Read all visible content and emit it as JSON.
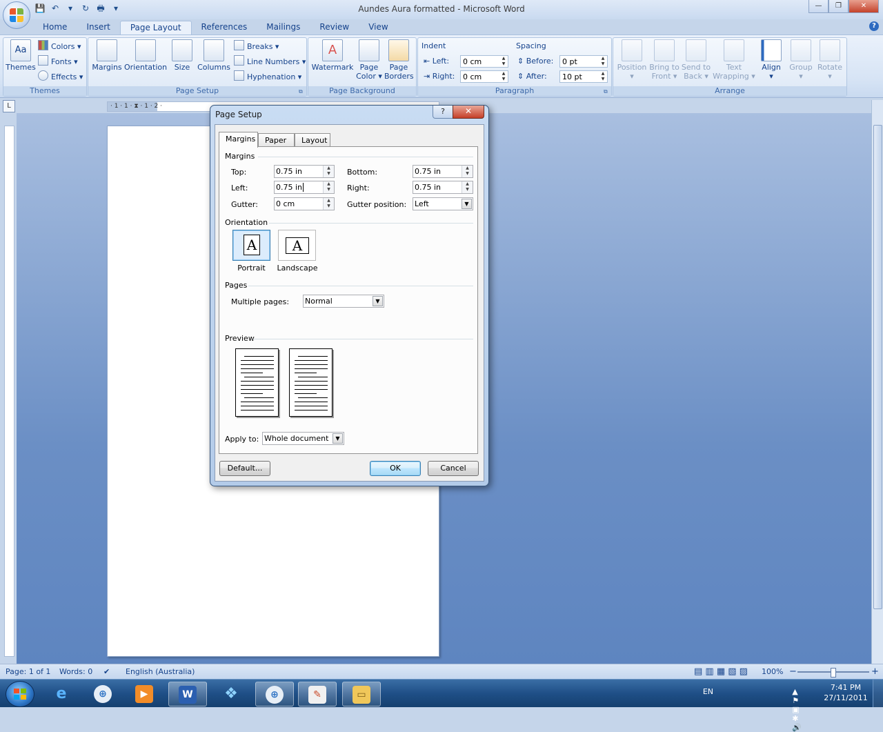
{
  "window": {
    "title": "Aundes Aura formatted - Microsoft Word",
    "minimize": "—",
    "maximize": "❐",
    "close": "✕"
  },
  "qat": {
    "save": "💾",
    "undo": "↶",
    "redo": "↻",
    "print": "🖶",
    "customize": "▾"
  },
  "tabs": [
    {
      "label": "Home"
    },
    {
      "label": "Insert"
    },
    {
      "label": "Page Layout"
    },
    {
      "label": "References"
    },
    {
      "label": "Mailings"
    },
    {
      "label": "Review"
    },
    {
      "label": "View"
    }
  ],
  "help": "?",
  "ribbon": {
    "themes": {
      "label": "Themes",
      "themes_btn": "Themes",
      "colors": "Colors ▾",
      "fonts": "Fonts ▾",
      "effects": "Effects ▾",
      "aa": "Aa"
    },
    "page_setup": {
      "label": "Page Setup",
      "margins": "Margins",
      "orientation": "Orientation",
      "size": "Size",
      "columns": "Columns",
      "breaks": "Breaks ▾",
      "line_numbers": "Line Numbers ▾",
      "hyphenation": "Hyphenation ▾",
      "dd": "▾"
    },
    "page_background": {
      "label": "Page Background",
      "watermark": "Watermark",
      "page_color_1": "Page",
      "page_color_2": "Color ▾",
      "page_borders_1": "Page",
      "page_borders_2": "Borders"
    },
    "paragraph": {
      "label": "Paragraph",
      "indent_title": "Indent",
      "spacing_title": "Spacing",
      "left_label": "Left:",
      "left_value": "0 cm",
      "right_label": "Right:",
      "right_value": "0 cm",
      "before_label": "Before:",
      "before_value": "0 pt",
      "after_label": "After:",
      "after_value": "10 pt"
    },
    "arrange": {
      "label": "Arrange",
      "position": "Position",
      "bring_1": "Bring to",
      "bring_2": "Front ▾",
      "send_1": "Send to",
      "send_2": "Back ▾",
      "wrap_1": "Text",
      "wrap_2": "Wrapping ▾",
      "align": "Align",
      "group": "Group",
      "rotate": "Rotate",
      "dd": "▾"
    }
  },
  "ruler": {
    "corner": "L",
    "marks": "· 1 · 1 · ⧗ · 1 · 2 ·"
  },
  "dialog": {
    "title": "Page Setup",
    "help_btn": "?",
    "close_btn": "✕",
    "tabs": [
      {
        "label": "Margins"
      },
      {
        "label": "Paper"
      },
      {
        "label": "Layout"
      }
    ],
    "margins_section": "Margins",
    "top_label": "Top:",
    "top_value": "0.75 in",
    "bottom_label": "Bottom:",
    "bottom_value": "0.75 in",
    "left_label": "Left:",
    "left_value": "0.75 in",
    "right_label": "Right:",
    "right_value": "0.75 in",
    "gutter_label": "Gutter:",
    "gutter_value": "0 cm",
    "gutter_pos_label": "Gutter position:",
    "gutter_pos_value": "Left",
    "orientation_section": "Orientation",
    "portrait": "Portrait",
    "landscape": "Landscape",
    "glyph": "A",
    "pages_section": "Pages",
    "multiple_pages_label": "Multiple pages:",
    "multiple_pages_value": "Normal",
    "preview_section": "Preview",
    "apply_to_label": "Apply to:",
    "apply_to_value": "Whole document",
    "default_btn": "Default...",
    "ok_btn": "OK",
    "cancel_btn": "Cancel",
    "spin_arrows": "▲▼",
    "dd_arrow": "▼"
  },
  "statusbar": {
    "page": "Page: 1 of 1",
    "words": "Words: 0",
    "language": "English (Australia)",
    "proof_icon": "✔",
    "zoom": "100%",
    "zoom_out": "−",
    "zoom_in": "+",
    "views": "▤ ▥ ▦ ▧ ▨"
  },
  "taskbar": {
    "apps": [
      {
        "name": "ie",
        "glyph": "e"
      },
      {
        "name": "safari",
        "glyph": "⊕"
      },
      {
        "name": "media",
        "glyph": "▶"
      },
      {
        "name": "word",
        "glyph": "W"
      },
      {
        "name": "dropbox",
        "glyph": "❖"
      },
      {
        "name": "safari2",
        "glyph": "⊕"
      },
      {
        "name": "paint",
        "glyph": "✎"
      },
      {
        "name": "explorer",
        "glyph": "▭"
      }
    ],
    "lang": "EN",
    "time": "7:41 PM",
    "date": "27/11/2011",
    "tray_icons": "▲ ⚑ ▣ ✱ 🔊"
  },
  "colors": {
    "accent": "#15428b",
    "ribbon_bg": "#dbe7f6",
    "doc_bg": "#6b8fc5",
    "taskbar": "#1f4f87"
  }
}
